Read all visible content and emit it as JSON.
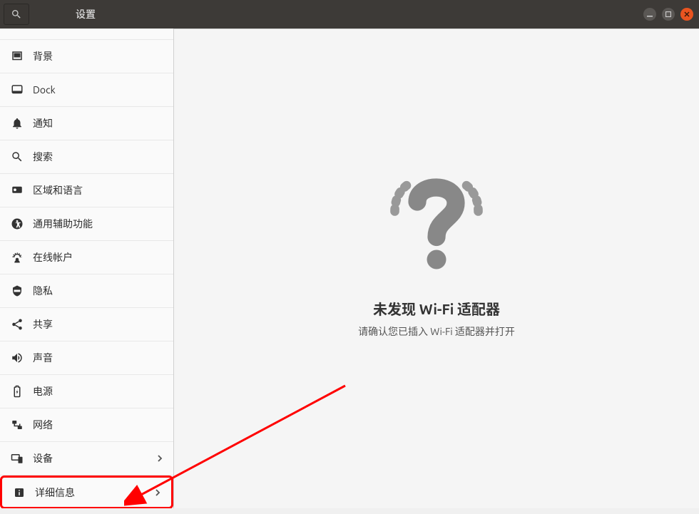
{
  "window": {
    "title": "设置"
  },
  "sidebar": {
    "items": [
      {
        "label": "背景",
        "icon": "background",
        "has_chevron": false
      },
      {
        "label": "Dock",
        "icon": "dock",
        "has_chevron": false
      },
      {
        "label": "通知",
        "icon": "notifications",
        "has_chevron": false
      },
      {
        "label": "搜索",
        "icon": "search",
        "has_chevron": false
      },
      {
        "label": "区域和语言",
        "icon": "region",
        "has_chevron": false
      },
      {
        "label": "通用辅助功能",
        "icon": "accessibility",
        "has_chevron": false
      },
      {
        "label": "在线帐户",
        "icon": "online-accounts",
        "has_chevron": false
      },
      {
        "label": "隐私",
        "icon": "privacy",
        "has_chevron": false
      },
      {
        "label": "共享",
        "icon": "sharing",
        "has_chevron": false
      },
      {
        "label": "声音",
        "icon": "sound",
        "has_chevron": false
      },
      {
        "label": "电源",
        "icon": "power",
        "has_chevron": false
      },
      {
        "label": "网络",
        "icon": "network",
        "has_chevron": false
      },
      {
        "label": "设备",
        "icon": "devices",
        "has_chevron": true
      },
      {
        "label": "详细信息",
        "icon": "details",
        "has_chevron": true,
        "highlighted": true
      }
    ]
  },
  "content": {
    "main_message": "未发现 Wi-Fi 适配器",
    "sub_message": "请确认您已插入 Wi-Fi 适配器并打开"
  }
}
